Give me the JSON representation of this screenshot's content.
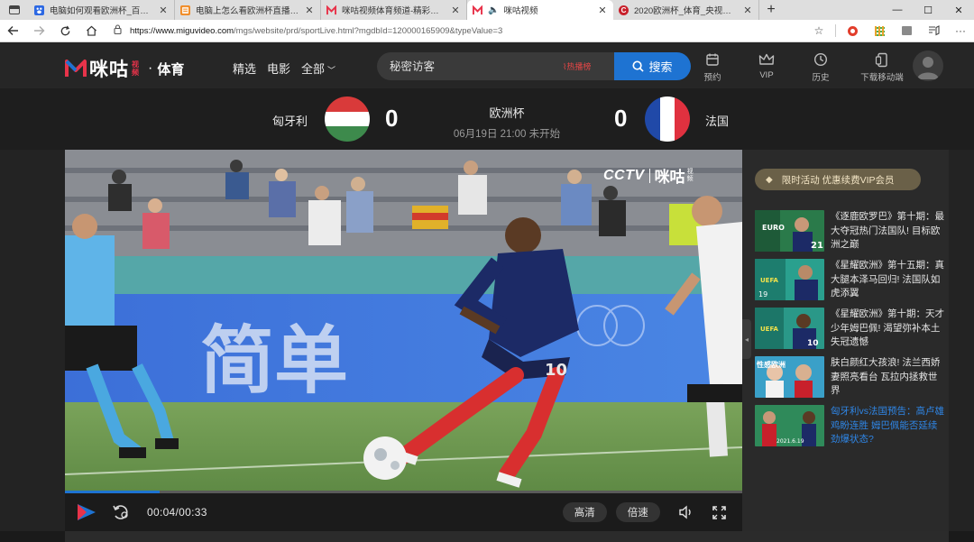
{
  "browser": {
    "tabs": [
      {
        "title": "电脑如何观看欧洲杯_百度搜索",
        "favicon": "baidu",
        "color": "#2c68e3"
      },
      {
        "title": "电脑上怎么看欧洲杯直播? 电脑版",
        "favicon": "orange",
        "color": "#f08a24"
      },
      {
        "title": "咪咕视频体育频道-精彩赛事在线",
        "favicon": "migu",
        "color": "#e8334a"
      },
      {
        "title": "咪咕视频",
        "favicon": "migu",
        "color": "#e8334a",
        "active": true,
        "audio": true
      },
      {
        "title": "2020欧洲杯_体育_央视网(cctv.com)",
        "favicon": "cctv",
        "color": "#c8202b"
      }
    ],
    "new_tab_label": "+",
    "url_main": "https://www.miguvideo.com",
    "url_rest": "/mgs/website/prd/sportLive.html?mgdbId=120000165909&typeValue=3"
  },
  "header": {
    "logo_text": "咪咕",
    "logo_sub": "视频",
    "logo_sep": "·",
    "section": "体育",
    "nav": [
      {
        "label": "精选"
      },
      {
        "label": "电影"
      },
      {
        "label": "全部",
        "has_caret": true
      }
    ],
    "search_placeholder": "秘密访客",
    "hot_label": "热播榜",
    "search_button": "搜索",
    "icons": [
      {
        "label": "预约",
        "icon": "calendar-icon"
      },
      {
        "label": "VIP",
        "icon": "crown-icon"
      },
      {
        "label": "历史",
        "icon": "clock-icon"
      },
      {
        "label": "下载移动端",
        "icon": "phone-icon"
      }
    ]
  },
  "match": {
    "home_team": "匈牙利",
    "home_score": "0",
    "away_team": "法国",
    "away_score": "0",
    "league": "欧洲杯",
    "time_status": "06月19日 21:00 未开始",
    "home_flag_colors": [
      "#d93a3a",
      "#ffffff",
      "#3d8a4c"
    ],
    "away_flag_colors": [
      "#2049a8",
      "#ffffff",
      "#e0313f"
    ]
  },
  "player": {
    "watermark_cctv": "CCTV",
    "watermark_brand": "咪咕",
    "watermark_sub": "视频",
    "board_text": "简单",
    "jersey_number": "10",
    "current_time": "00:04",
    "duration": "00:33",
    "progress": 0.14,
    "quality_label": "高清",
    "speed_label": "倍速"
  },
  "side": {
    "promo": "限时活动 优惠续费VIP会员",
    "related": [
      {
        "title": "《逐鹿欧罗巴》第十期：最大夺冠热门法国队! 目标欧洲之巅",
        "highlight": false,
        "thumb_tag": "21"
      },
      {
        "title": "《星耀欧洲》第十五期：真大腿本泽马回归! 法国队如虎添翼",
        "highlight": false,
        "thumb_tag": "19"
      },
      {
        "title": "《星耀欧洲》第十期：天才少年姆巴佩! 渴望弥补本土失冠遗憾",
        "highlight": false,
        "thumb_tag": "10"
      },
      {
        "title": "肤白颜红大孩浪! 法兰西娇妻照亮看台 瓦拉内拯救世界",
        "highlight": false,
        "thumb_tag": "性感欧洲"
      },
      {
        "title": "匈牙利vs法国预告：高卢雄鸡盼连胜 姆巴佩能否延续劲爆状态?",
        "highlight": true,
        "thumb_tag": "2021.6.19"
      }
    ]
  }
}
